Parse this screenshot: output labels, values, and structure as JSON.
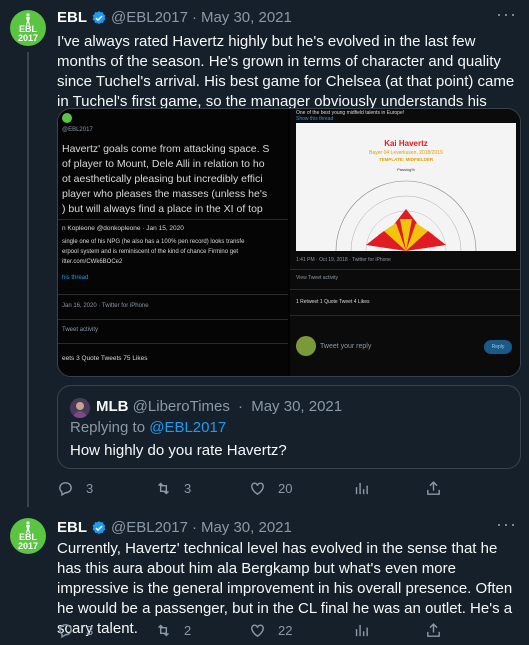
{
  "tweets": [
    {
      "name": "EBL",
      "handle": "@EBL2017",
      "date": "May 30, 2021",
      "avatar_text": "EBL 2017",
      "text": "I've always rated Havertz highly but he's evolved in the last few months of the season. He's grown in terms of character and quality since Tuchel's arrival. His best game for Chelsea (at that point) came in Tuchel's first game, so the manager obviously understands his profile.",
      "media": {
        "left": {
          "handle": "@EBL2017",
          "lines": [
            "Havertz' goals come from attacking space. S",
            "of player to Mount, Dele Alli in relation to ho",
            "ot aesthetically pleasing but incredibly effici",
            " player who pleases the masses (unless he's",
            ") but will always find a place in the XI of top"
          ],
          "quoted_author": "n Kopleone @donkopleone · Jan 15, 2020",
          "quoted_lines": [
            "single one of his NPG (he also has a 100% pen record) looks transfe",
            "erpool system and is reminiscent of the kind of chance Firmino get",
            "itter.com/CWk6BOCe2"
          ],
          "show_thread": "his thread",
          "timestamp": "Jan 16, 2020 · Twitter for iPhone",
          "activity": "Tweet activity",
          "stats": "eets   3 Quote Tweets   75 Likes"
        },
        "right": {
          "top_text": "One of the best young midfield talents in Europe!",
          "show_thread": "Show this thread",
          "card_title": "Kai Havertz",
          "card_subtitle": "Bayer 04 Leverkusen, 2018/2019",
          "card_template": "TEMPLATE: MIDFIELDER",
          "card_axis": "Passing%",
          "timestamp": "1:41 PM · Oct 19, 2018 · Twitter for iPhone",
          "activity": "View Tweet activity",
          "stats": "1 Retweet   1 Quote Tweet   4 Likes",
          "reply_placeholder": "Tweet your reply",
          "reply_button": "Reply"
        }
      },
      "quote": {
        "name": "MLB",
        "handle": "@LiberoTimes",
        "date": "May 30, 2021",
        "replying_label": "Replying to",
        "replying_handle": "@EBL2017",
        "text": "How highly do you rate Havertz?"
      },
      "actions": {
        "replies": "3",
        "retweets": "3",
        "likes": "20"
      }
    },
    {
      "name": "EBL",
      "handle": "@EBL2017",
      "date": "May 30, 2021",
      "avatar_text": "EBL 2017",
      "text": "Currently, Havertz' technical level has evolved in the sense that he has this aura about him ala Bergkamp but what's even more impressive is the general improvement in his overall presence. Often he would be a passenger, but in the CL final he was an outlet. He's a scary talent.",
      "actions": {
        "replies": "3",
        "retweets": "2",
        "likes": "22"
      }
    }
  ],
  "ui": {
    "separator": "·",
    "more": "···"
  },
  "colors": {
    "background": "#15202b",
    "text": "#f7f9f9",
    "muted": "#8b98a5",
    "border": "#38444d",
    "accent": "#1d9bf0",
    "avatar": "#5cc443"
  }
}
